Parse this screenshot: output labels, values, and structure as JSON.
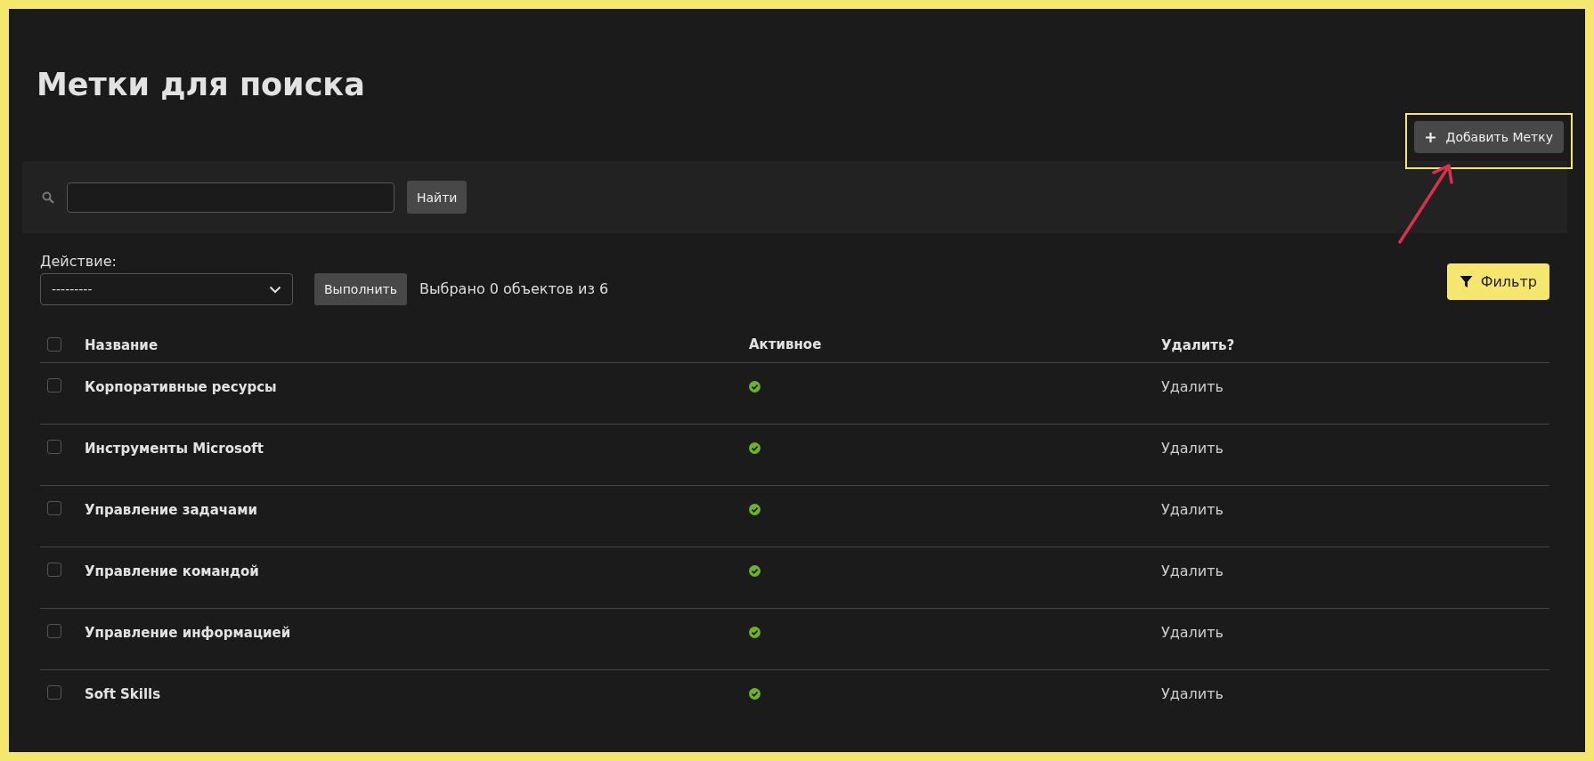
{
  "page_title": "Метки для поиска",
  "add_button": {
    "label": "Добавить Метку",
    "highlighted": true
  },
  "search": {
    "button": "Найти"
  },
  "action": {
    "label": "Действие:",
    "value": "---------",
    "run_button": "Выполнить",
    "selection_count": "Выбрано 0 объектов из 6"
  },
  "filter_button": "Фильтр",
  "table": {
    "select_all_checked": false,
    "columns": [
      "Название",
      "Активное",
      "Удалить?"
    ],
    "rows": [
      {
        "name": "Корпоративные ресурсы",
        "active": true,
        "delete": "Удалить",
        "selected": false
      },
      {
        "name": "Инструменты Microsoft",
        "active": true,
        "delete": "Удалить",
        "selected": false
      },
      {
        "name": "Управление задачами",
        "active": true,
        "delete": "Удалить",
        "selected": false
      },
      {
        "name": "Управление командой",
        "active": true,
        "delete": "Удалить",
        "selected": false
      },
      {
        "name": "Управление информацией",
        "active": true,
        "delete": "Удалить",
        "selected": false
      },
      {
        "name": "Soft Skills",
        "active": true,
        "delete": "Удалить",
        "selected": false
      }
    ]
  }
}
